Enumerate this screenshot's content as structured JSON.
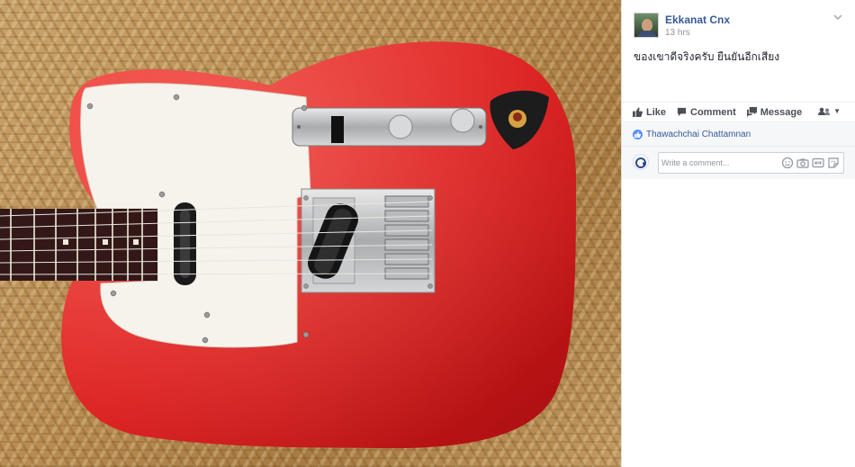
{
  "post": {
    "author": "Ekkanat Cnx",
    "timestamp": "13 hrs",
    "text": "ของเขาดีจริงครับ ยืนยันอีกเสียง"
  },
  "actions": {
    "like": "Like",
    "comment": "Comment",
    "message": "Message"
  },
  "reactions": {
    "liker": "Thawachchai Chattamnan"
  },
  "comment_box": {
    "placeholder": "Write a comment..."
  },
  "colors": {
    "link": "#365899",
    "guitar_body": "#d81a1a",
    "pickguard": "#f6f3ec",
    "like_badge": "#5890ff"
  },
  "icons": {
    "like": "thumbs-up-icon",
    "comment": "speech-bubble-icon",
    "message": "messenger-icon",
    "audience": "audience-selector-icon",
    "menu": "chevron-down-icon",
    "emoji": "emoji-icon",
    "camera": "camera-icon",
    "gif": "gif-icon",
    "sticker": "sticker-icon"
  }
}
